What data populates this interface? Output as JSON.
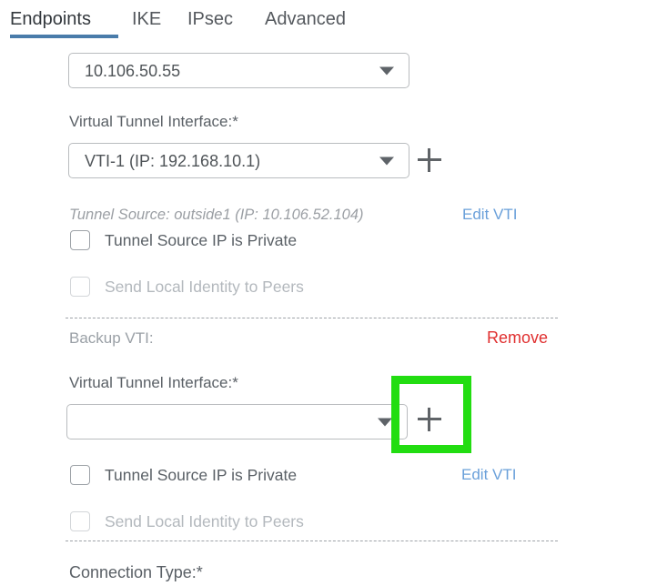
{
  "tabs": [
    {
      "label": "Endpoints",
      "active": true
    },
    {
      "label": "IKE",
      "active": false
    },
    {
      "label": "IPsec",
      "active": false
    },
    {
      "label": "Advanced",
      "active": false
    }
  ],
  "accent_color": "#4a7caa",
  "link_color": "#6aa0da",
  "remove_color": "#e03030",
  "highlight_color": "#22dd11",
  "primary_vti": {
    "device_select": {
      "value": "10.106.50.55",
      "placeholder": ""
    },
    "vti_label": "Virtual Tunnel Interface:*",
    "vti_select": {
      "value": "VTI-1 (IP: 192.168.10.1)",
      "placeholder": ""
    },
    "add_icon": "plus-icon",
    "tunnel_source_text": "Tunnel Source: outside1 (IP: 10.106.52.104)",
    "edit_vti_label": "Edit VTI",
    "tunnel_source_private": {
      "label": "Tunnel Source IP is Private",
      "checked": false,
      "disabled": false
    },
    "send_local_identity": {
      "label": "Send Local Identity to Peers",
      "checked": false,
      "disabled": true
    }
  },
  "backup_vti": {
    "title": "Backup VTI:",
    "remove_label": "Remove",
    "vti_label": "Virtual Tunnel Interface:*",
    "vti_select": {
      "value": "",
      "placeholder": ""
    },
    "add_icon": "plus-icon",
    "edit_vti_label": "Edit VTI",
    "tunnel_source_private": {
      "label": "Tunnel Source IP is Private",
      "checked": false,
      "disabled": false
    },
    "send_local_identity": {
      "label": "Send Local Identity to Peers",
      "checked": false,
      "disabled": true
    }
  },
  "connection_type_label": "Connection Type:*"
}
